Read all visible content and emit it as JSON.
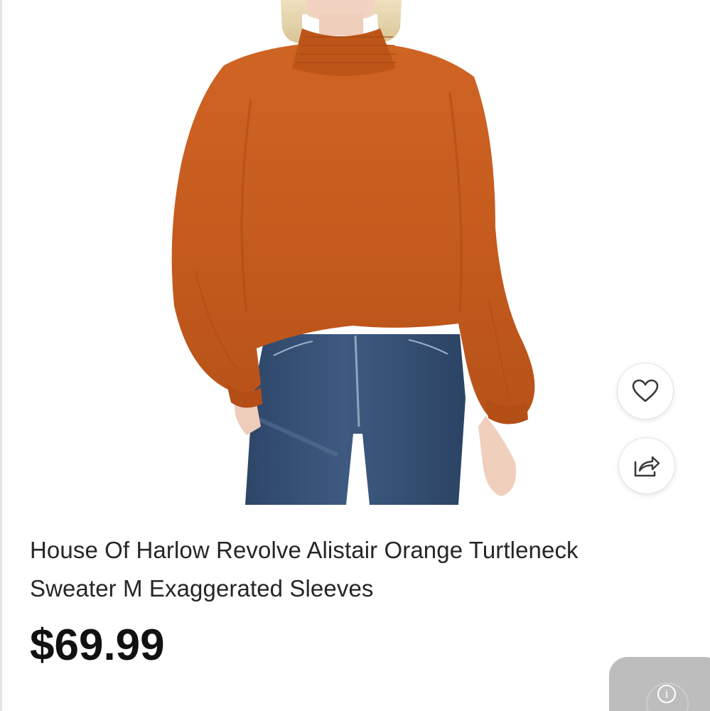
{
  "product": {
    "title_line1": "House Of Harlow Revolve Alistair Orange Turtleneck",
    "title_line2": "Sweater M Exaggerated Sleeves",
    "price": "$69.99",
    "sweater_color": "#c65a1e"
  },
  "actions": {
    "like_icon": "heart-outline-icon",
    "share_icon": "share-arrow-icon",
    "info_icon": "info-icon",
    "info_glyph": "i"
  },
  "colors": {
    "background": "#ffffff",
    "title_text": "#262626",
    "price_text": "#111111",
    "widget_bg": "#bdbdbd"
  }
}
